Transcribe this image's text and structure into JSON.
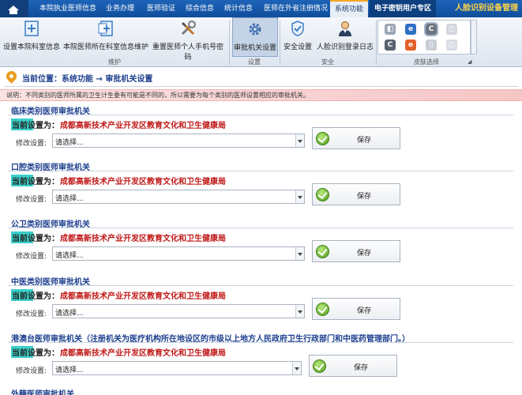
{
  "nav": {
    "tabs": [
      {
        "label": "本院执业医师信息"
      },
      {
        "label": "业务办理"
      },
      {
        "label": "医师验证"
      },
      {
        "label": "综合信息"
      },
      {
        "label": "统计信息"
      },
      {
        "label": "医师在外省注册情况"
      },
      {
        "label": "系统功能"
      },
      {
        "label": "电子密钥用户专区"
      },
      {
        "label": "人脸识别设备管理"
      }
    ],
    "active_tab": "系统功能"
  },
  "ribbon": {
    "buttons": [
      {
        "label": "设置本院科室信息",
        "icon": "add-doc-icon"
      },
      {
        "label": "本院医师所在科室信息维护",
        "icon": "add-doc-icon"
      },
      {
        "label": "重置医师个人手机号密码",
        "icon": "tools-icon"
      },
      {
        "label": "审批机关设置",
        "icon": "gear-icon"
      },
      {
        "label": "安全设置",
        "icon": "shield-icon"
      },
      {
        "label": "人脸识别登录日志",
        "icon": "user-icon"
      }
    ],
    "groups": [
      "维护",
      "设置",
      "安全",
      "皮肤选择"
    ]
  },
  "breadcrumb": {
    "text": "当前位置：系统功能 → 审批机关设置"
  },
  "notice": "说明：不同类别的医师所属的卫生计生委有可能是不同的，所以需要为每个类别的医师设置相应的审批机关。",
  "common": {
    "current_label": "当前设置为：",
    "modify_label": "修改设置:",
    "select_placeholder": "请选择...",
    "save_label": "保存"
  },
  "sections": [
    {
      "title": "临床类别医师审批机关",
      "current": "成都高新技术产业开发区教育文化和卫生健康局"
    },
    {
      "title": "口腔类别医师审批机关",
      "current": "成都高新技术产业开发区教育文化和卫生健康局"
    },
    {
      "title": "公卫类别医师审批机关",
      "current": "成都高新技术产业开发区教育文化和卫生健康局"
    },
    {
      "title": "中医类别医师审批机关",
      "current": "成都高新技术产业开发区教育文化和卫生健康局"
    },
    {
      "title": "港澳台医师审批机关（注册机关为医疗机构所在地设区的市级以上地方人民政府卫生行政部门和中医药管理部门。）",
      "current": "成都高新技术产业开发区教育文化和卫生健康局"
    },
    {
      "title": "外籍医师审批机关"
    }
  ]
}
